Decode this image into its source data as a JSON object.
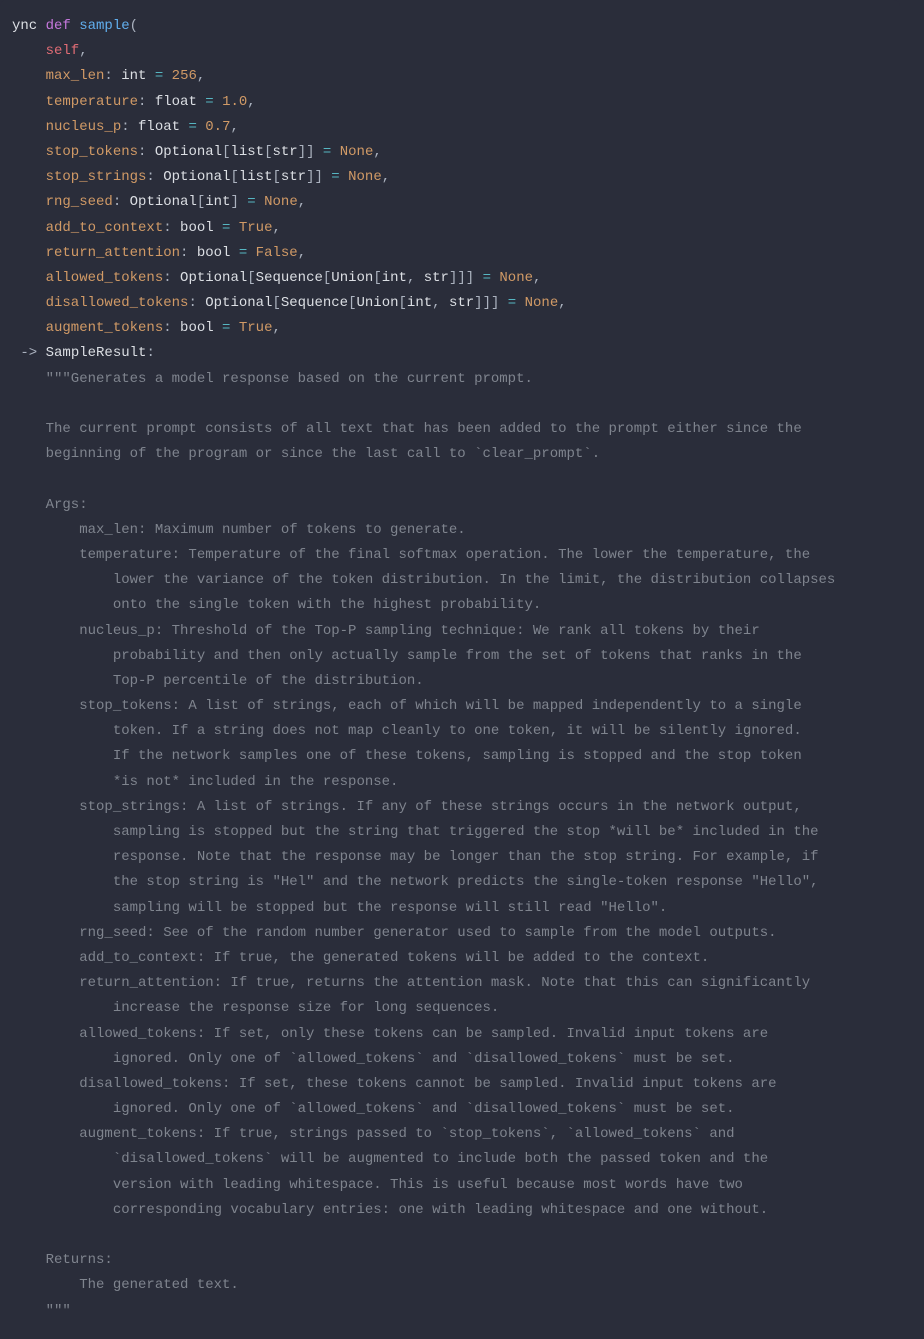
{
  "code": {
    "l1_async": "ync ",
    "l1_def": "def ",
    "l1_fn": "sample",
    "l1_open": "(",
    "l2_self": "    self",
    "l2_comma": ",",
    "l3_param": "    max_len",
    "l3_colon": ": ",
    "l3_type": "int",
    "l3_eq": " = ",
    "l3_val": "256",
    "l3_comma": ",",
    "l4_param": "    temperature",
    "l4_colon": ": ",
    "l4_type": "float",
    "l4_eq": " = ",
    "l4_val": "1.0",
    "l4_comma": ",",
    "l5_param": "    nucleus_p",
    "l5_colon": ": ",
    "l5_type": "float",
    "l5_eq": " = ",
    "l5_val": "0.7",
    "l5_comma": ",",
    "l6_param": "    stop_tokens",
    "l6_colon": ": ",
    "l6_type1": "Optional",
    "l6_br1": "[",
    "l6_type2": "list",
    "l6_br2": "[",
    "l6_type3": "str",
    "l6_br3": "]]",
    "l6_eq": " = ",
    "l6_val": "None",
    "l6_comma": ",",
    "l7_param": "    stop_strings",
    "l7_colon": ": ",
    "l7_type1": "Optional",
    "l7_br1": "[",
    "l7_type2": "list",
    "l7_br2": "[",
    "l7_type3": "str",
    "l7_br3": "]]",
    "l7_eq": " = ",
    "l7_val": "None",
    "l7_comma": ",",
    "l8_param": "    rng_seed",
    "l8_colon": ": ",
    "l8_type1": "Optional",
    "l8_br1": "[",
    "l8_type2": "int",
    "l8_br2": "]",
    "l8_eq": " = ",
    "l8_val": "None",
    "l8_comma": ",",
    "l9_param": "    add_to_context",
    "l9_colon": ": ",
    "l9_type": "bool",
    "l9_eq": " = ",
    "l9_val": "True",
    "l9_comma": ",",
    "l10_param": "    return_attention",
    "l10_colon": ": ",
    "l10_type": "bool",
    "l10_eq": " = ",
    "l10_val": "False",
    "l10_comma": ",",
    "l11_param": "    allowed_tokens",
    "l11_colon": ": ",
    "l11_type1": "Optional",
    "l11_br1": "[",
    "l11_type2": "Sequence",
    "l11_br2": "[",
    "l11_type3": "Union",
    "l11_br3": "[",
    "l11_type4": "int",
    "l11_comma1": ", ",
    "l11_type5": "str",
    "l11_br4": "]]]",
    "l11_eq": " = ",
    "l11_val": "None",
    "l11_comma": ",",
    "l12_param": "    disallowed_tokens",
    "l12_colon": ": ",
    "l12_type1": "Optional",
    "l12_br1": "[",
    "l12_type2": "Sequence",
    "l12_br2": "[",
    "l12_type3": "Union",
    "l12_br3": "[",
    "l12_type4": "int",
    "l12_comma1": ", ",
    "l12_type5": "str",
    "l12_br4": "]]]",
    "l12_eq": " = ",
    "l12_val": "None",
    "l12_comma": ",",
    "l13_param": "    augment_tokens",
    "l13_colon": ": ",
    "l13_type": "bool",
    "l13_eq": " = ",
    "l13_val": "True",
    "l13_comma": ",",
    "l14_close": " -> ",
    "l14_ret": "SampleResult",
    "l14_colon": ":",
    "docstring": "    \"\"\"Generates a model response based on the current prompt.\n\n    The current prompt consists of all text that has been added to the prompt either since the\n    beginning of the program or since the last call to `clear_prompt`.\n\n    Args:\n        max_len: Maximum number of tokens to generate.\n        temperature: Temperature of the final softmax operation. The lower the temperature, the\n            lower the variance of the token distribution. In the limit, the distribution collapses\n            onto the single token with the highest probability.\n        nucleus_p: Threshold of the Top-P sampling technique: We rank all tokens by their\n            probability and then only actually sample from the set of tokens that ranks in the\n            Top-P percentile of the distribution.\n        stop_tokens: A list of strings, each of which will be mapped independently to a single\n            token. If a string does not map cleanly to one token, it will be silently ignored.\n            If the network samples one of these tokens, sampling is stopped and the stop token\n            *is not* included in the response.\n        stop_strings: A list of strings. If any of these strings occurs in the network output,\n            sampling is stopped but the string that triggered the stop *will be* included in the\n            response. Note that the response may be longer than the stop string. For example, if\n            the stop string is \"Hel\" and the network predicts the single-token response \"Hello\",\n            sampling will be stopped but the response will still read \"Hello\".\n        rng_seed: See of the random number generator used to sample from the model outputs.\n        add_to_context: If true, the generated tokens will be added to the context.\n        return_attention: If true, returns the attention mask. Note that this can significantly\n            increase the response size for long sequences.\n        allowed_tokens: If set, only these tokens can be sampled. Invalid input tokens are\n            ignored. Only one of `allowed_tokens` and `disallowed_tokens` must be set.\n        disallowed_tokens: If set, these tokens cannot be sampled. Invalid input tokens are\n            ignored. Only one of `allowed_tokens` and `disallowed_tokens` must be set.\n        augment_tokens: If true, strings passed to `stop_tokens`, `allowed_tokens` and\n            `disallowed_tokens` will be augmented to include both the passed token and the\n            version with leading whitespace. This is useful because most words have two\n            corresponding vocabulary entries: one with leading whitespace and one without.\n\n    Returns:\n        The generated text.\n    \"\"\""
  }
}
